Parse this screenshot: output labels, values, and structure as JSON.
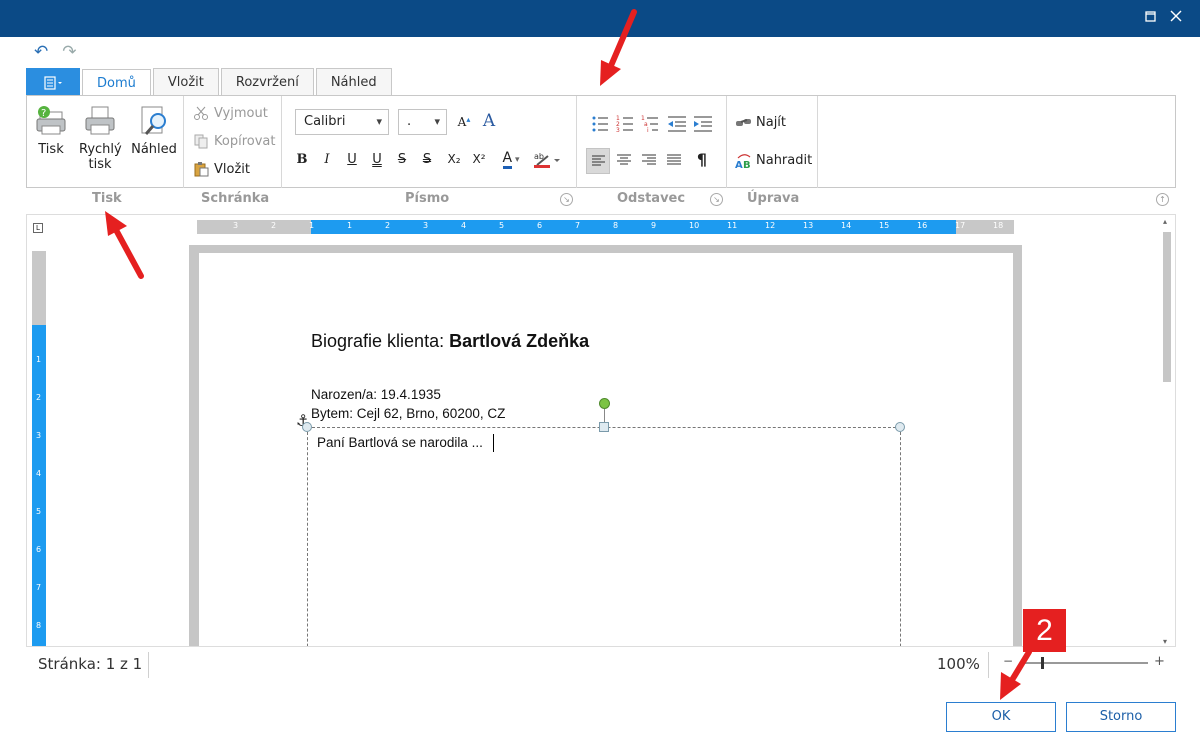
{
  "window": {
    "restore_icon": "restore-icon",
    "close_icon": "close-icon"
  },
  "qat": {
    "undo_icon": "undo-icon",
    "redo_icon": "redo-icon"
  },
  "tabs": {
    "file_icon": "menu-icon",
    "items": [
      "Domů",
      "Vložit",
      "Rozvržení",
      "Náhled"
    ],
    "active": "Domů"
  },
  "ribbon": {
    "print_group": {
      "label": "Tisk",
      "print": "Tisk",
      "quick_print_1": "Rychlý",
      "quick_print_2": "tisk",
      "preview": "Náhled"
    },
    "clipboard_group": {
      "label": "Schránka",
      "cut": "Vyjmout",
      "copy": "Kopírovat",
      "paste": "Vložit"
    },
    "font_group": {
      "label": "Písmo",
      "font_name": "Calibri",
      "font_size": ".",
      "bold": "B",
      "italic": "I",
      "underline": "U",
      "double_underline": "U",
      "strike": "S",
      "double_strike": "S",
      "subscript": "X₂",
      "superscript": "X²",
      "font_color": "A"
    },
    "paragraph_group": {
      "label": "Odstavec",
      "pilcrow": "¶"
    },
    "edit_group": {
      "label": "Úprava",
      "find": "Najít",
      "replace": "Nahradit"
    }
  },
  "ruler": {
    "h_ticks": [
      "3",
      "2",
      "1",
      "1",
      "2",
      "3",
      "4",
      "5",
      "6",
      "7",
      "8",
      "9",
      "10",
      "11",
      "12",
      "13",
      "14",
      "15",
      "16",
      "17",
      "18"
    ],
    "v_ticks": [
      "1",
      "2",
      "3",
      "4",
      "5",
      "6",
      "7",
      "8"
    ]
  },
  "document": {
    "title_prefix": "Biografie klienta: ",
    "title_name": "Bartlová Zdeňka",
    "born": "Narozen/a: 19.4.1935",
    "address": "Bytem: Cejl 62, Brno, 60200, CZ",
    "textbox_text": "Paní Bartlová se narodila ..."
  },
  "status": {
    "page": "Stránka: 1 z 1",
    "zoom": "100%",
    "zoom_fraction": 0.15,
    "zoom_minus": "−",
    "zoom_plus": "+"
  },
  "buttons": {
    "ok": "OK",
    "cancel": "Storno"
  },
  "annotation": {
    "badge": "2"
  },
  "colors": {
    "titlebar": "#0b4a86",
    "accent": "#2b8ee0",
    "ruler_blue": "#1d9bf0",
    "annotation_red": "#e52020"
  }
}
